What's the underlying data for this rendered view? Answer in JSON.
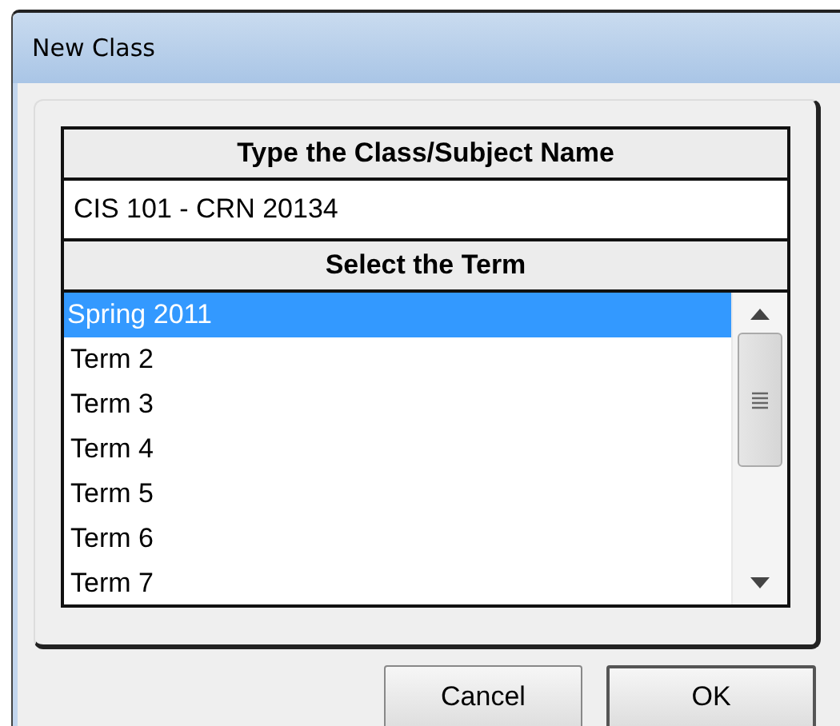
{
  "window": {
    "title": "New Class"
  },
  "name_section": {
    "heading": "Type the Class/Subject Name",
    "value": "CIS 101 - CRN 20134"
  },
  "term_section": {
    "heading": "Select the Term",
    "terms": [
      {
        "label": "Spring 2011",
        "selected": true
      },
      {
        "label": "Term 2",
        "selected": false
      },
      {
        "label": "Term 3",
        "selected": false
      },
      {
        "label": "Term 4",
        "selected": false
      },
      {
        "label": "Term 5",
        "selected": false
      },
      {
        "label": "Term 6",
        "selected": false
      },
      {
        "label": "Term 7",
        "selected": false
      }
    ]
  },
  "buttons": [
    {
      "label": "Cancel",
      "default": false
    },
    {
      "label": "OK",
      "default": true
    }
  ]
}
